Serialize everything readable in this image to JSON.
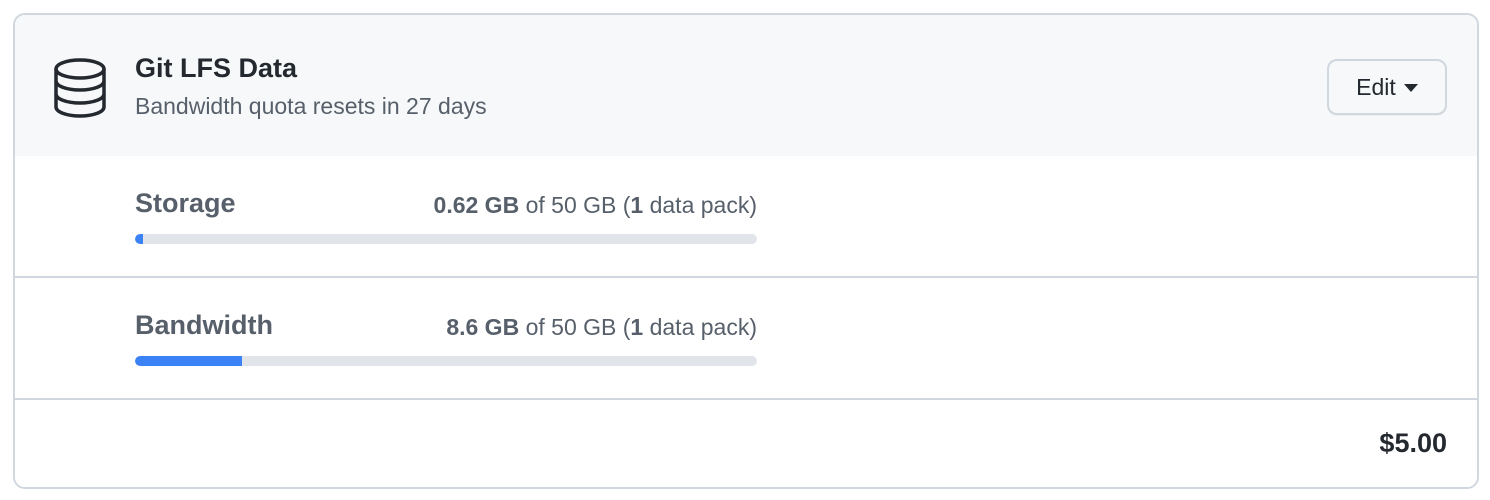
{
  "header": {
    "icon": "database-icon",
    "title": "Git LFS Data",
    "subtitle": "Bandwidth quota resets in 27 days",
    "edit_label": "Edit"
  },
  "storage": {
    "label": "Storage",
    "used": "0.62 GB",
    "of_text": " of 50 GB (",
    "packs": "1",
    "packs_suffix": " data pack)",
    "fraction": 0.0124
  },
  "bandwidth": {
    "label": "Bandwidth",
    "used": "8.6 GB",
    "of_text": " of 50 GB (",
    "packs": "1",
    "packs_suffix": " data pack)",
    "fraction": 0.172
  },
  "footer": {
    "price": "$5.00"
  },
  "colors": {
    "accent": "#3b82f6",
    "track": "#e1e4e8",
    "border": "#d0d7de"
  }
}
